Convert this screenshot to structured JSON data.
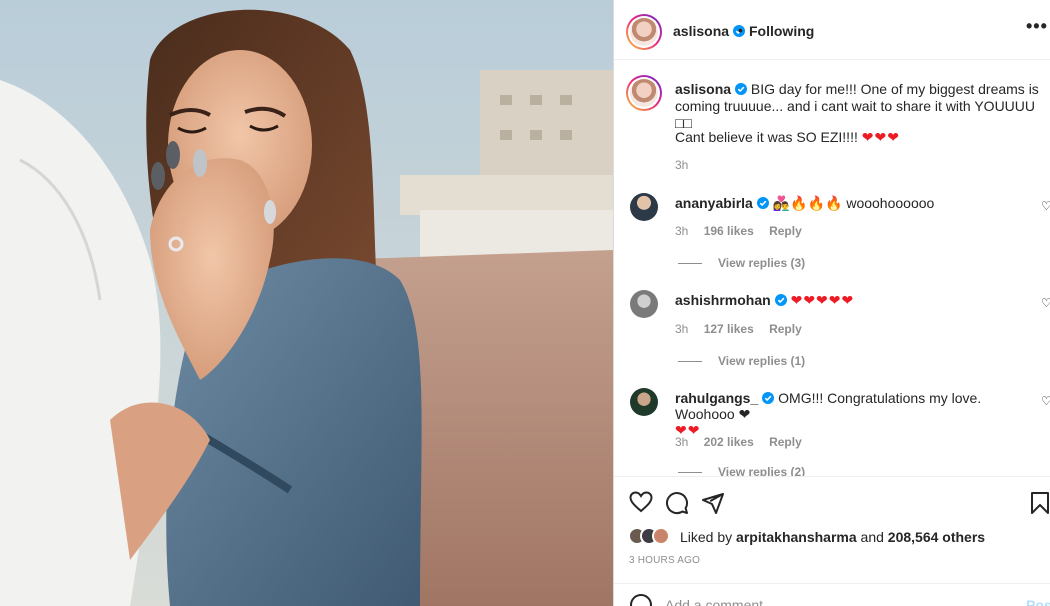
{
  "post": {
    "username": "aslisona",
    "follow_label": "Following",
    "separator": "•",
    "more_label": "•••"
  },
  "caption": {
    "username": "aslisona",
    "text": "BIG day for me!!! One of my biggest dreams is coming truuuue... and i cant wait to share it with YOUUUU □□",
    "text2": "Cant believe it was SO EZI!!!!",
    "hearts": "❤❤❤",
    "time": "3h"
  },
  "comments": [
    {
      "username": "ananyabirla",
      "text": "👩‍❤️‍👨🔥🔥🔥 wooohoooooo",
      "time": "3h",
      "likes": "196 likes",
      "reply": "Reply",
      "view_replies": "View replies (3)"
    },
    {
      "username": "ashishrmohan",
      "text": "❤❤❤❤❤",
      "time": "3h",
      "likes": "127 likes",
      "reply": "Reply",
      "view_replies": "View replies (1)"
    },
    {
      "username": "rahulgangs_",
      "text": "OMG!!! Congratulations my love. Woohooo ❤",
      "text_line2": "❤❤",
      "time": "3h",
      "likes": "202 likes",
      "reply": "Reply",
      "view_replies": "View replies (2)"
    }
  ],
  "likes": {
    "prefix": "Liked by",
    "user": "arpitakhansharma",
    "middle": "and",
    "others": "208,564 others"
  },
  "time_ago": "3 HOURS AGO",
  "add_comment": {
    "placeholder": "Add a comment...",
    "post_label": "Post"
  },
  "icons": [
    "heart-icon",
    "comment-icon",
    "share-icon",
    "bookmark-icon",
    "verified-icon",
    "more-icon",
    "emoji-icon"
  ],
  "colors": {
    "accent": "#0095f6",
    "heart": "#ed1c24",
    "muted": "#8e8e8e",
    "text": "#262626"
  }
}
